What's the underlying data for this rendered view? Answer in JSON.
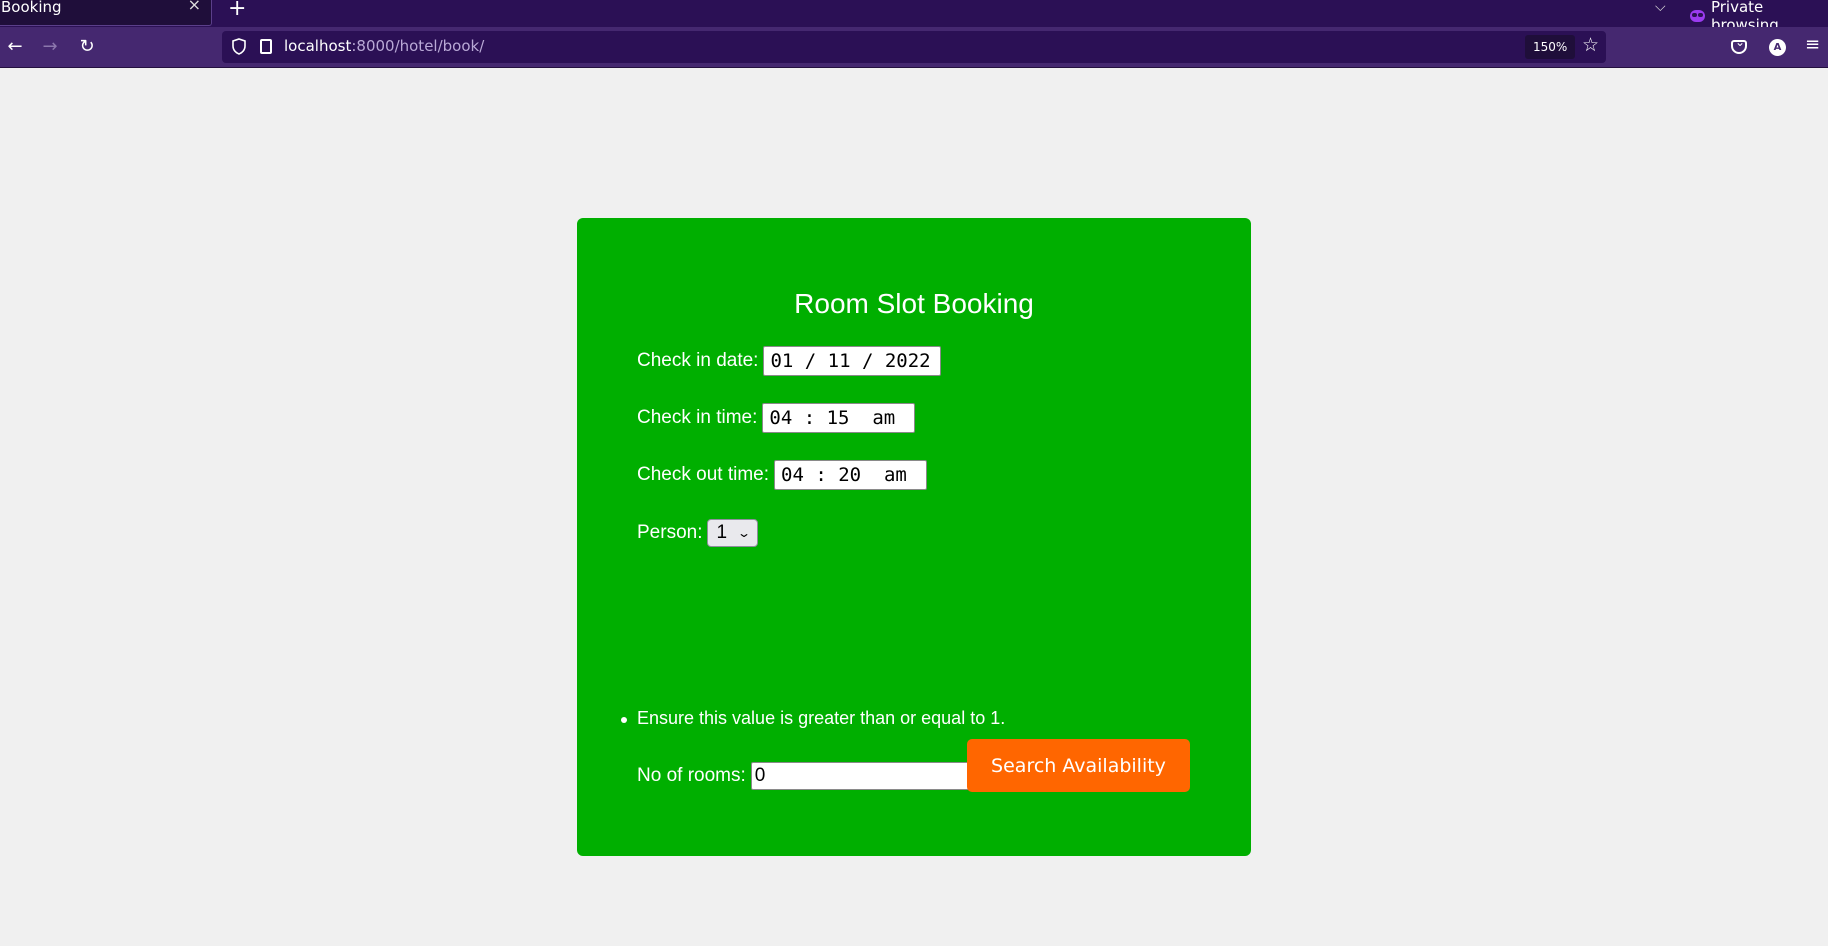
{
  "browser": {
    "tab_title": "Booking",
    "tab_close": "×",
    "new_tab": "+",
    "tab_list": "⌵",
    "private_label": "Private browsing",
    "back": "←",
    "forward": "→",
    "reload": "↻",
    "url_host": "localhost",
    "url_rest": ":8000/hotel/book/",
    "zoom_level": "150%",
    "bookmark_star": "☆",
    "account_initial": "A",
    "menu": "≡"
  },
  "form": {
    "title": "Room Slot Booking",
    "checkin_date_label": "Check in date:",
    "checkin_date_value": "01 / 11 / 2022",
    "checkin_time_label": "Check in time:",
    "checkin_time_value": "04 : 15  am",
    "checkout_time_label": "Check out time:",
    "checkout_time_value": "04 : 20  am",
    "person_label": "Person:",
    "person_value": "1",
    "person_chevron": "⌄",
    "errors": [
      "Ensure this value is greater than or equal to 1."
    ],
    "rooms_label": "No of rooms:",
    "rooms_value": "0",
    "spin_up": "︿",
    "spin_down": "﹀",
    "submit_label": "Search Availability"
  },
  "colors": {
    "card_bg": "#00af00",
    "button_bg": "#ff6600",
    "browser_chrome": "#2b1055"
  }
}
